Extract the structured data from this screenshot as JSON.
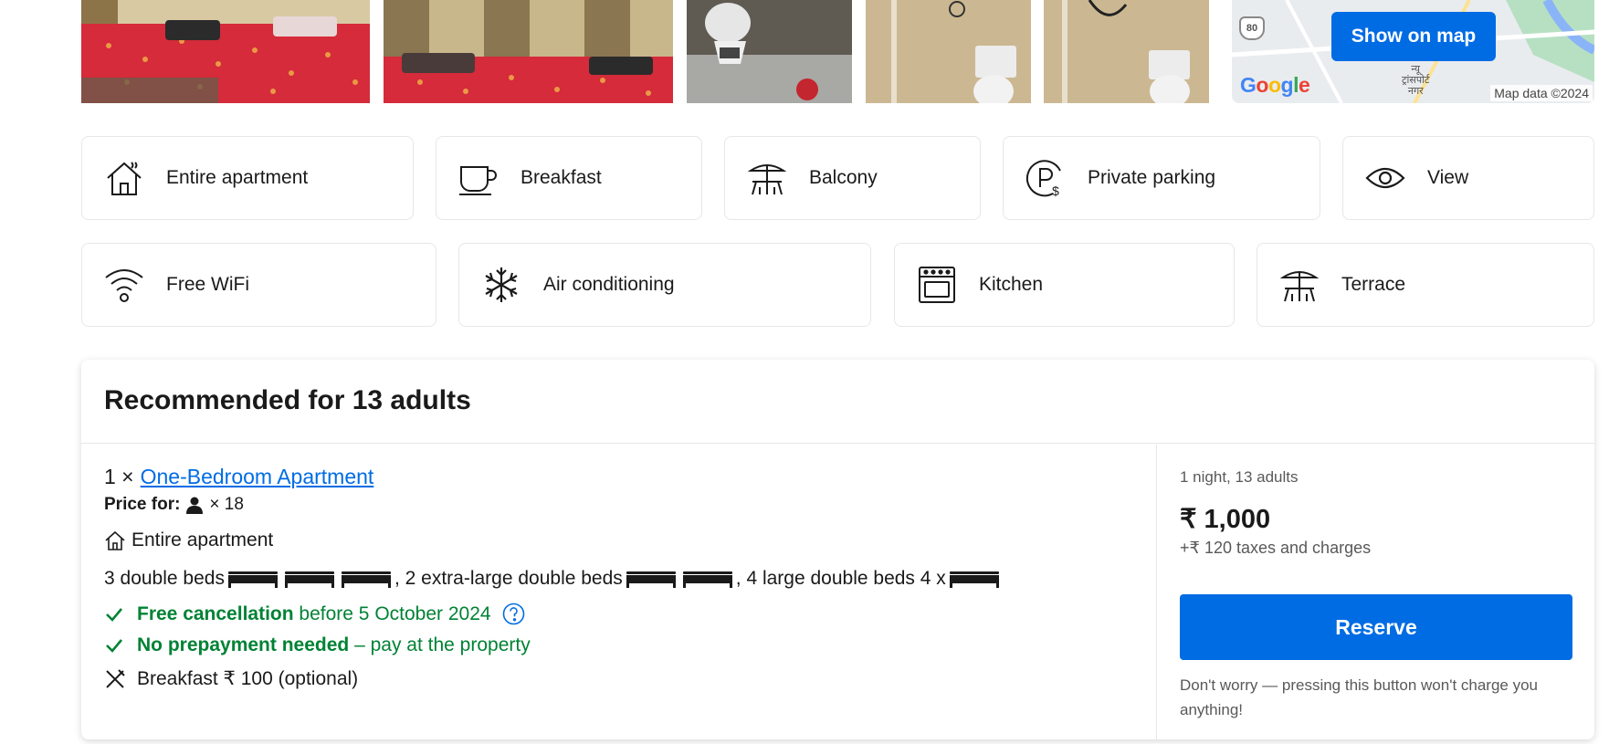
{
  "map": {
    "button_label": "Show on map",
    "credit": "Map data ©2024",
    "road_shield": "80",
    "place_label_line1": "न्यू",
    "place_label_line2": "ट्रांसपोर्ट",
    "place_label_line3": "नगर",
    "logo": [
      "G",
      "o",
      "o",
      "g",
      "l",
      "e"
    ]
  },
  "facilities_row1": [
    {
      "label": "Entire apartment",
      "icon": "house-icon"
    },
    {
      "label": "Breakfast",
      "icon": "cup-icon"
    },
    {
      "label": "Balcony",
      "icon": "balcony-icon"
    },
    {
      "label": "Private parking",
      "icon": "parking-icon"
    },
    {
      "label": "View",
      "icon": "eye-icon"
    }
  ],
  "facilities_row2": [
    {
      "label": "Free WiFi",
      "icon": "wifi-icon"
    },
    {
      "label": "Air conditioning",
      "icon": "snowflake-icon"
    },
    {
      "label": "Kitchen",
      "icon": "oven-icon"
    },
    {
      "label": "Terrace",
      "icon": "terrace-icon"
    }
  ],
  "recommended": {
    "title": "Recommended for 13 adults",
    "room_count": "1 ×",
    "room_name": "One-Bedroom Apartment",
    "price_for_label": "Price for:",
    "price_for_count": "× 18",
    "unit_type": "Entire apartment",
    "beds_part1": "3 double beds",
    "beds_part2": ", 2 extra-large double beds",
    "beds_part3": ", 4 large double beds 4 x",
    "cancellation_bold": "Free cancellation",
    "cancellation_rest": "before 5 October 2024",
    "prepayment_bold": "No prepayment needed",
    "prepayment_rest": "– pay at the property",
    "breakfast": "Breakfast ₹ 100 (optional)",
    "nights": "1 night, 13 adults",
    "price": "₹ 1,000",
    "taxes": "+₹ 120 taxes and charges",
    "reserve_label": "Reserve",
    "note": "Don't worry — pressing this button won't charge you anything!"
  },
  "colors": {
    "primary": "#006ce4",
    "green": "#008234",
    "text": "#1a1a1a",
    "muted": "#595959"
  }
}
